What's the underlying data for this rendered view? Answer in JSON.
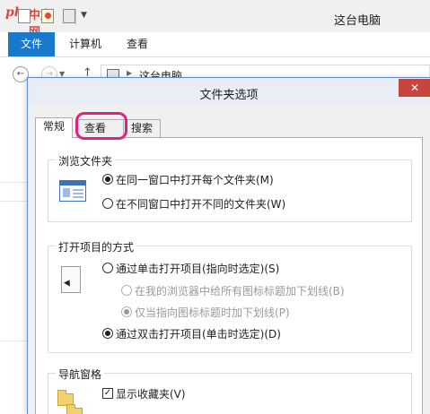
{
  "watermark": {
    "text_latin": "php",
    "text_cn": "中文网"
  },
  "explorer": {
    "title": "这台电脑",
    "ribbon_tabs": [
      "文件",
      "计算机",
      "查看"
    ],
    "address": {
      "crumb": "这台电脑"
    }
  },
  "dialog": {
    "title": "文件夹选项",
    "close_label": "✕",
    "tabs": [
      "常规",
      "查看",
      "搜索"
    ],
    "groups": {
      "browse": {
        "title": "浏览文件夹",
        "options": [
          {
            "label": "在同一窗口中打开每个文件夹(M)",
            "checked": true
          },
          {
            "label": "在不同窗口中打开不同的文件夹(W)",
            "checked": false
          }
        ]
      },
      "click": {
        "title": "打开项目的方式",
        "options": [
          {
            "label": "通过单击打开项目(指向时选定)(S)",
            "checked": false
          },
          {
            "label": "在我的浏览器中给所有图标标题加下划线(B)",
            "checked": false,
            "disabled": true
          },
          {
            "label": "仅当指向图标标题时加下划线(P)",
            "checked": true,
            "disabled": true
          },
          {
            "label": "通过双击打开项目(单击时选定)(D)",
            "checked": true
          }
        ]
      },
      "nav": {
        "title": "导航窗格",
        "options": [
          {
            "label": "显示收藏夹(V)",
            "checked": true
          }
        ]
      }
    }
  },
  "colors": {
    "accent": "#1979ca",
    "close": "#c7453f",
    "highlight": "#e0217f"
  }
}
